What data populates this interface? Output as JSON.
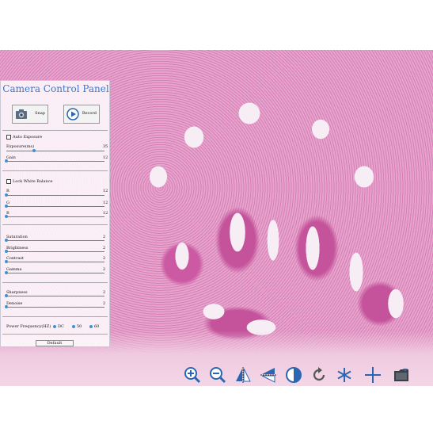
{
  "panel": {
    "title": "Camera Control Panel",
    "snap_label": "Snap",
    "record_label": "Record",
    "auto_exposure": {
      "label": "Auto Exposure",
      "checked": false
    },
    "exposure": {
      "label": "Exposure(ms)",
      "value": "35",
      "fraction": 0.28
    },
    "gain": {
      "label": "Gain",
      "value": "12",
      "fraction": 0.0
    },
    "lock_white_balance": {
      "label": "Lock White Balance",
      "checked": false
    },
    "r": {
      "label": "R",
      "value": "12",
      "fraction": 0.0
    },
    "g": {
      "label": "G",
      "value": "12",
      "fraction": 0.0
    },
    "b": {
      "label": "B",
      "value": "12",
      "fraction": 0.0
    },
    "saturation": {
      "label": "Saturation",
      "value": "2",
      "fraction": 0.0
    },
    "brightness": {
      "label": "Brightness",
      "value": "2",
      "fraction": 0.0
    },
    "contrast": {
      "label": "Contrast",
      "value": "2",
      "fraction": 0.0
    },
    "gamma": {
      "label": "Gamma",
      "value": "2",
      "fraction": 0.0
    },
    "sharpness": {
      "label": "Sharpness",
      "value": "2",
      "fraction": 0.0
    },
    "denoise": {
      "label": "Denoise",
      "value": "2",
      "fraction": 0.0
    },
    "power_frequency": {
      "label": "Power Frequency(HZ)",
      "options": [
        "DC",
        "50",
        "60"
      ]
    },
    "default_label": "Default"
  },
  "toolbar": {
    "icons": [
      "zoom-in-icon",
      "zoom-out-icon",
      "flip-horizontal-icon",
      "flip-vertical-icon",
      "invert-color-icon",
      "rotate-icon",
      "freeze-icon",
      "crosshair-icon",
      "folder-icon"
    ]
  },
  "colors": {
    "accent": "#3d78c8",
    "slider_thumb": "#3f8fd6",
    "toolbar_icon": "#2a66b3"
  }
}
